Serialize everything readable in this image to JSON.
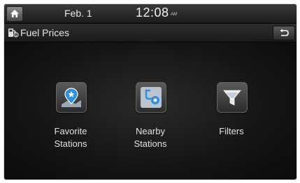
{
  "status_bar": {
    "date": "Feb.  1",
    "time": "12:08",
    "ampm": "AM"
  },
  "title_bar": {
    "title": "Fuel Prices"
  },
  "menu": {
    "items": [
      {
        "line1": "Favorite",
        "line2": "Stations",
        "icon": "favorite-pin-icon"
      },
      {
        "line1": "Nearby",
        "line2": "Stations",
        "icon": "nearby-route-icon"
      },
      {
        "line1": "Filters",
        "line2": "",
        "icon": "filter-funnel-icon"
      }
    ]
  },
  "colors": {
    "accent_blue": "#2f8fe0",
    "background": "#111111"
  }
}
